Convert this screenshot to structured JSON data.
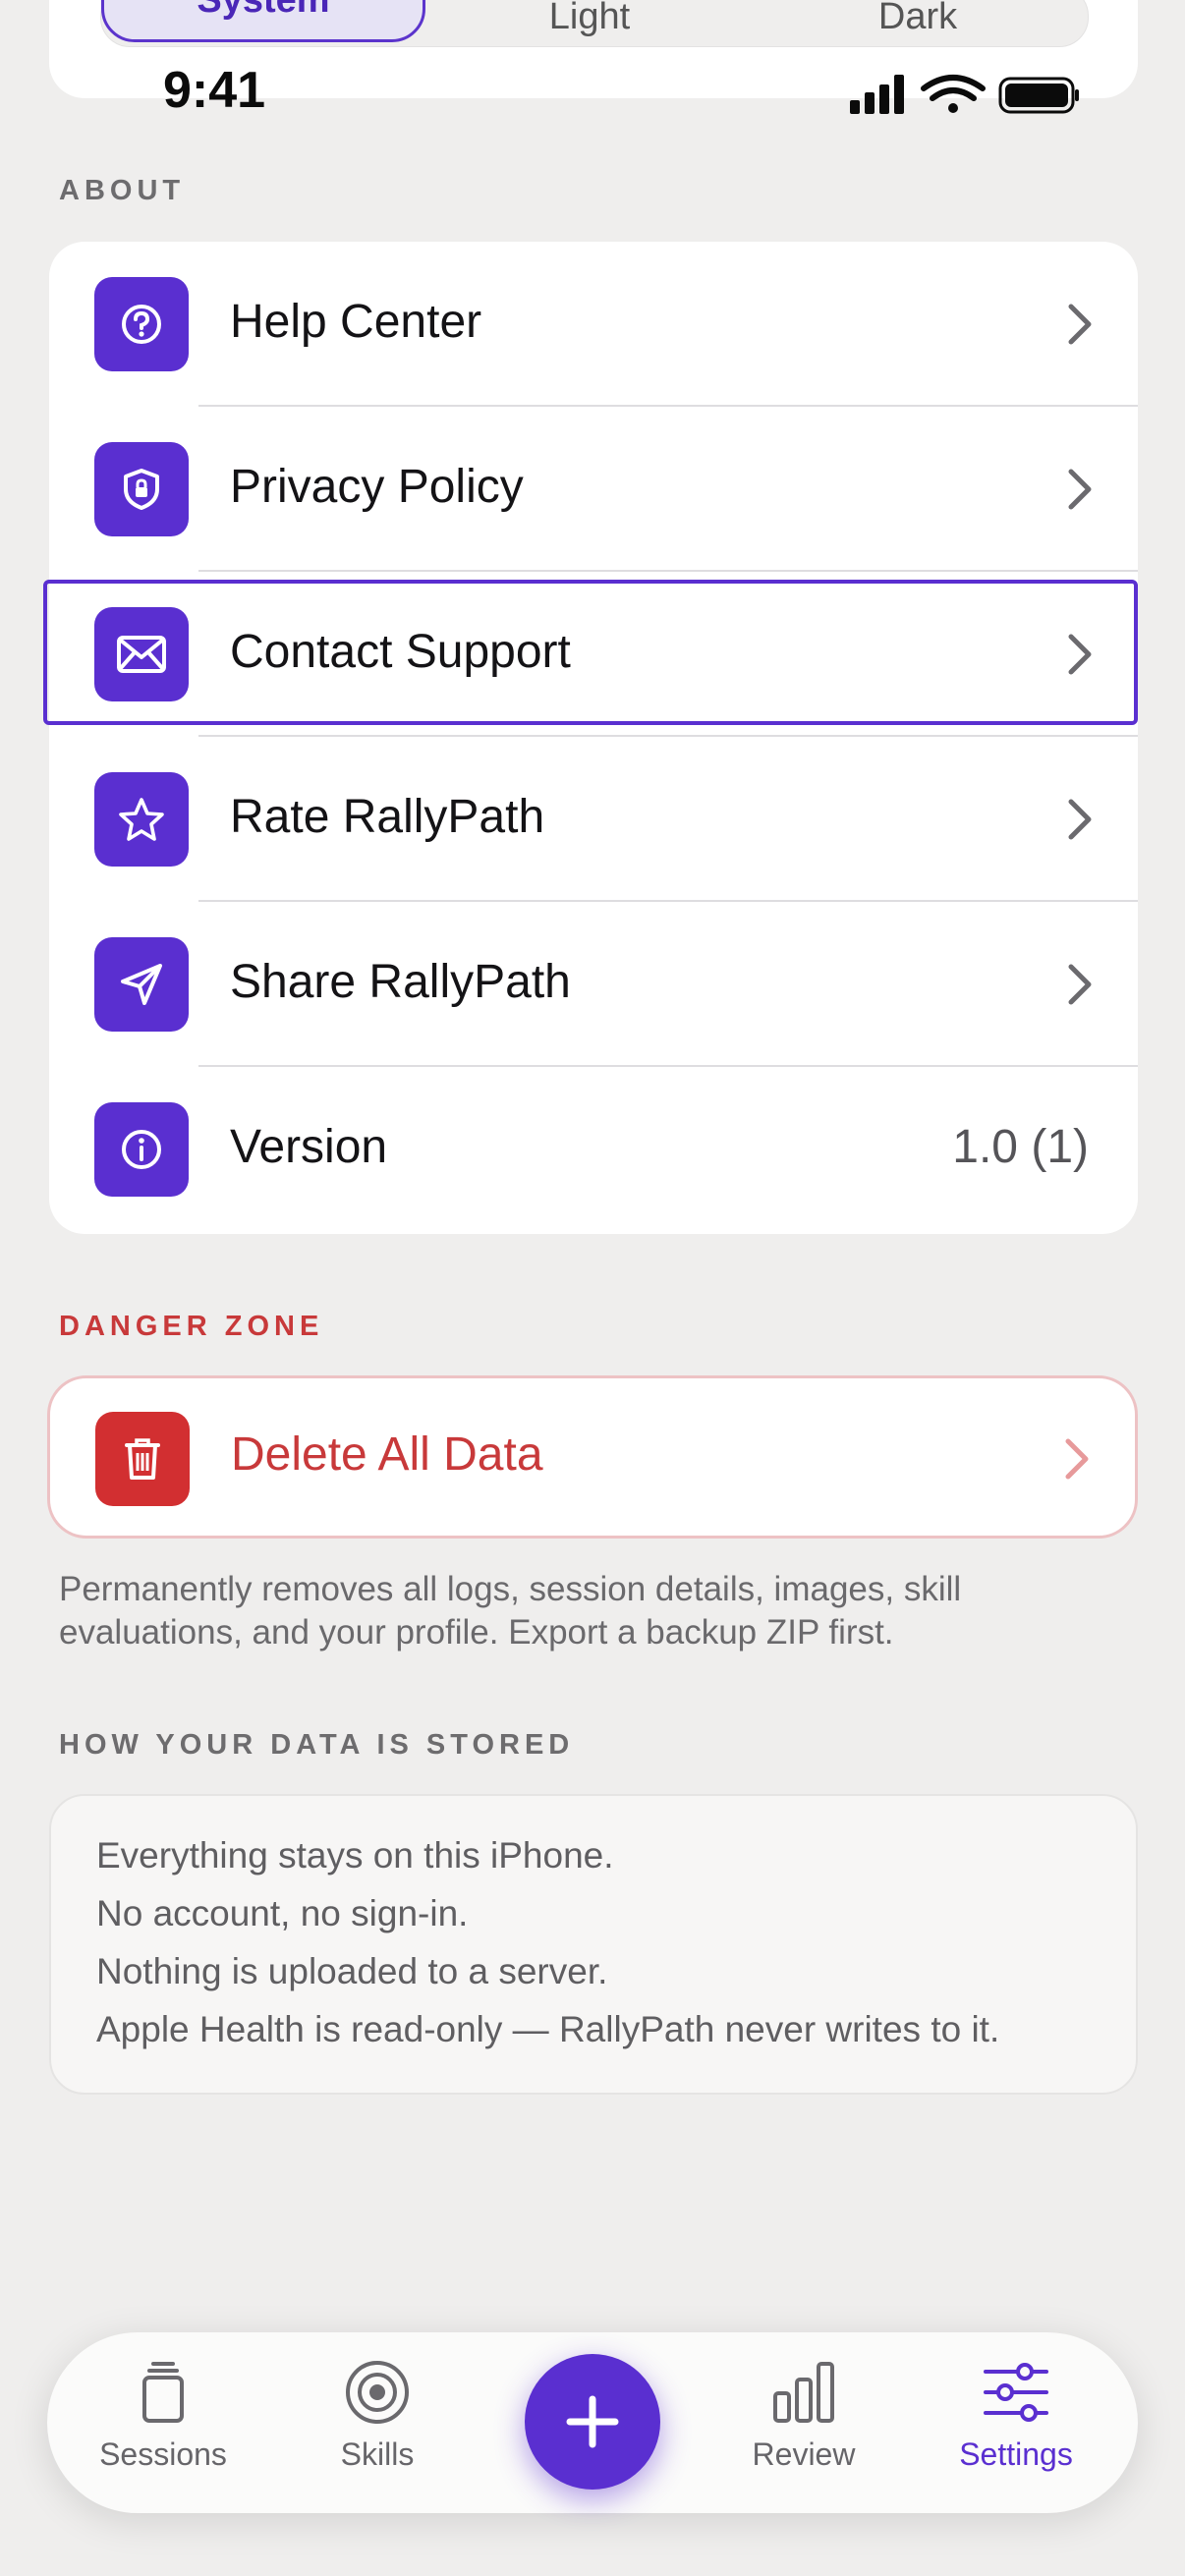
{
  "appearance": {
    "options": [
      "System",
      "Light",
      "Dark"
    ],
    "selected": "System"
  },
  "status_bar": {
    "time": "9:41"
  },
  "about": {
    "header": "ABOUT",
    "items": [
      {
        "label": "Help Center",
        "icon": "question-icon"
      },
      {
        "label": "Privacy Policy",
        "icon": "shield-lock-icon"
      },
      {
        "label": "Contact Support",
        "icon": "envelope-icon"
      },
      {
        "label": "Rate RallyPath",
        "icon": "star-icon"
      },
      {
        "label": "Share RallyPath",
        "icon": "paper-plane-icon"
      },
      {
        "label": "Version",
        "icon": "info-icon",
        "value": "1.0 (1)"
      }
    ]
  },
  "danger_zone": {
    "header": "DANGER ZONE",
    "delete_label": "Delete All Data",
    "note": "Permanently removes all logs, session details, images, skill evaluations, and your profile. Export a backup ZIP first."
  },
  "storage": {
    "header": "HOW YOUR DATA IS STORED",
    "lines": [
      "Everything stays on this iPhone.",
      "No account, no sign-in.",
      "Nothing is uploaded to a server.",
      "Apple Health is read-only — RallyPath never writes to it."
    ]
  },
  "tabbar": {
    "tabs": [
      {
        "label": "Sessions",
        "icon": "sessions-icon"
      },
      {
        "label": "Skills",
        "icon": "target-icon"
      },
      {
        "label": "Review",
        "icon": "bar-chart-icon"
      },
      {
        "label": "Settings",
        "icon": "sliders-icon"
      }
    ],
    "active": "Settings"
  },
  "colors": {
    "accent": "#5a2fd0",
    "danger": "#d22f31",
    "background": "#efeeed"
  }
}
